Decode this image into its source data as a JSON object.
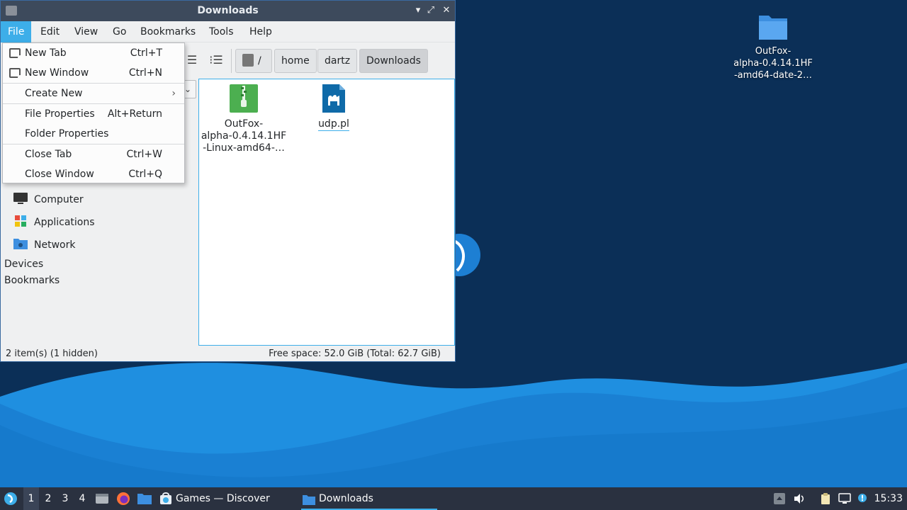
{
  "desktop": {
    "icon_label": "OutFox-\nalpha-0.4.14.1HF\n-amd64-date-2…"
  },
  "window": {
    "title": "Downloads"
  },
  "menubar": {
    "items": [
      "File",
      "Edit",
      "View",
      "Go",
      "Bookmarks",
      "Tools",
      "Help"
    ]
  },
  "breadcrumbs": {
    "root": "/",
    "items": [
      "home",
      "dartz",
      "Downloads"
    ]
  },
  "file_menu": {
    "new_tab": "New Tab",
    "new_tab_sc": "Ctrl+T",
    "new_window": "New Window",
    "new_window_sc": "Ctrl+N",
    "create_new": "Create New",
    "file_properties": "File Properties",
    "file_properties_sc": "Alt+Return",
    "folder_properties": "Folder Properties",
    "close_tab": "Close Tab",
    "close_tab_sc": "Ctrl+W",
    "close_window": "Close Window",
    "close_window_sc": "Ctrl+Q"
  },
  "sidebar": {
    "places": [
      "Computer",
      "Applications",
      "Network"
    ],
    "sections": [
      "Devices",
      "Bookmarks"
    ]
  },
  "files": [
    {
      "name": "OutFox-\nalpha-0.4.14.1HF\n-Linux-amd64-…",
      "icon": "archive-icon"
    },
    {
      "name": "udp.pl",
      "icon": "perl-script-icon"
    }
  ],
  "statusbar": {
    "items": "2 item(s) (1 hidden)",
    "free_space": "Free space: 52.0 GiB (Total: 62.7 GiB)"
  },
  "taskbar": {
    "workspaces": [
      "1",
      "2",
      "3",
      "4"
    ],
    "tasks": [
      "Games — Discover",
      "Downloads"
    ],
    "clock": "15:33"
  },
  "colors": {
    "accent": "#3daee9",
    "titlebar": "#3d4a5c",
    "taskbar": "#2a3140"
  }
}
